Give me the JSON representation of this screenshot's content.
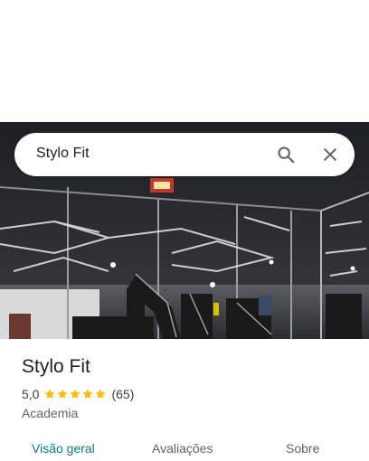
{
  "search": {
    "query": "Stylo Fit"
  },
  "place": {
    "name": "Stylo Fit",
    "rating": "5,0",
    "stars": 5,
    "review_count": "(65)",
    "category": "Academia"
  },
  "tabs": [
    {
      "label": "Visão geral",
      "active": true
    },
    {
      "label": "Avaliações",
      "active": false
    },
    {
      "label": "Sobre",
      "active": false
    }
  ],
  "colors": {
    "accent": "#0b7f7b",
    "star": "#fbbc04"
  },
  "icons": {
    "search": "search-icon",
    "close": "close-icon",
    "star": "star-icon"
  }
}
